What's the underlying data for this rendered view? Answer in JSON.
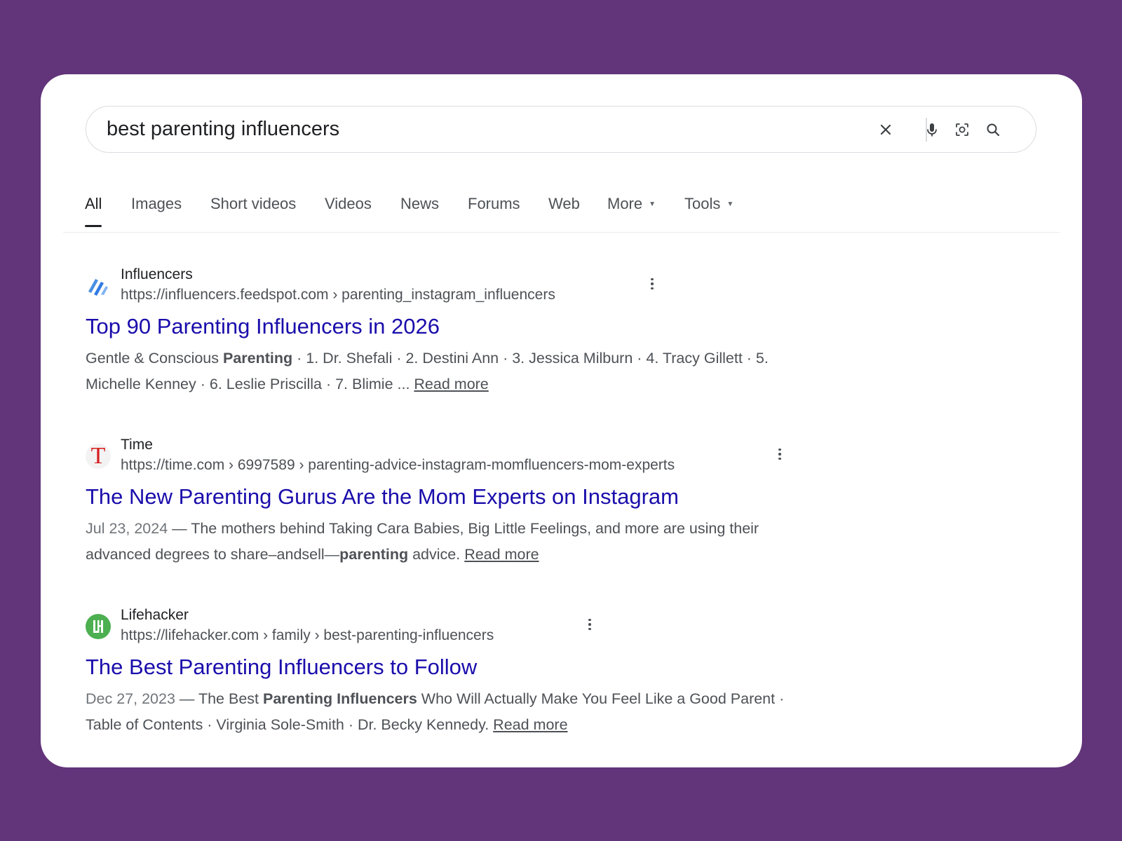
{
  "search": {
    "query": "best parenting influencers"
  },
  "icons": {
    "clear": "close-icon",
    "voice": "microphone-icon",
    "lens": "lens-icon",
    "search": "search-icon"
  },
  "tabs": [
    {
      "label": "All",
      "active": true
    },
    {
      "label": "Images"
    },
    {
      "label": "Short videos"
    },
    {
      "label": "Videos"
    },
    {
      "label": "News"
    },
    {
      "label": "Forums"
    },
    {
      "label": "Web"
    },
    {
      "label": "More",
      "dropdown": true
    },
    {
      "label": "Tools",
      "dropdown": true
    }
  ],
  "results": [
    {
      "site_name": "Influencers",
      "url": "https://influencers.feedspot.com › parenting_instagram_influencers",
      "title": "Top 90 Parenting Influencers in 2026",
      "snippet_line1_a": "Gentle & Conscious ",
      "snippet_line1_bold": "Parenting",
      "snippet_line1_b": " · 1. Dr. Shefali · 2. Destini Ann · 3. Jessica Milburn · 4. Tracy Gillett · 5.",
      "snippet_line2": "Michelle Kenney · 6. Leslie Priscilla · 7. Blimie ... ",
      "read_more": "Read more"
    },
    {
      "site_name": "Time",
      "url": "https://time.com › 6997589 › parenting-advice-instagram-momfluencers-mom-experts",
      "title": "The New Parenting Gurus Are the Mom Experts on Instagram",
      "date": "Jul 23, 2024",
      "snippet_a": " — The mothers behind Taking Cara Babies, Big Little Feelings, and more are using their advanced degrees to share–andsell—",
      "snippet_bold": "parenting",
      "snippet_b": " advice. ",
      "read_more": "Read more"
    },
    {
      "site_name": "Lifehacker",
      "url": "https://lifehacker.com › family › best-parenting-influencers",
      "title": "The Best Parenting Influencers to Follow",
      "date": "Dec 27, 2023",
      "snippet_a": " — The Best ",
      "snippet_bold": "Parenting Influencers",
      "snippet_b": " Who Will Actually Make You Feel Like a Good Parent · Table of Contents · Virginia Sole-Smith · Dr. Becky Kennedy. ",
      "read_more": "Read more"
    }
  ],
  "colors": {
    "background": "#62347a",
    "link": "#1a0dab",
    "text": "#4d5156",
    "time_red": "#d61e1e",
    "lifehacker_green": "#4caf50"
  }
}
